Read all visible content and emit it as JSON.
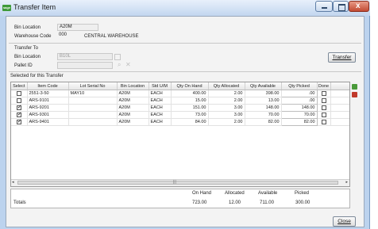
{
  "window": {
    "title": "Transfer Item",
    "logo": "sage"
  },
  "header": {
    "bin_location_label": "Bin Location",
    "bin_location_value": "A20M",
    "warehouse_code_label": "Warehouse Code",
    "warehouse_code_value": "000",
    "warehouse_name": "CENTRAL WAREHOUSE"
  },
  "transfer_to": {
    "section_label": "Transfer To",
    "bin_location_label": "Bin Location",
    "bin_location_value": "B10L",
    "pallet_id_label": "Pallet ID",
    "pallet_id_value": ""
  },
  "buttons": {
    "transfer": "Transfer",
    "close": "Close"
  },
  "grid": {
    "section_label": "Selected for this Transfer",
    "columns": [
      "Select",
      "Item Code",
      "Lot Serial No",
      "Bin Location",
      "Std U/M",
      "Qty On Hand",
      "Qty Allocated",
      "Qty Available",
      "Qty Picked",
      "Done"
    ],
    "rows": [
      {
        "select": false,
        "item_code": "2551-3-50",
        "lot_serial": "MAY10",
        "bin": "A20M",
        "um": "EACH",
        "on_hand": "400.00",
        "allocated": "2.00",
        "available": "398.00",
        "picked": ".00",
        "done": false
      },
      {
        "select": false,
        "item_code": "ARS-9101",
        "lot_serial": "",
        "bin": "A20M",
        "um": "EACH",
        "on_hand": "15.00",
        "allocated": "2.00",
        "available": "13.00",
        "picked": ".00",
        "done": false
      },
      {
        "select": true,
        "item_code": "ARS-9201",
        "lot_serial": "",
        "bin": "A20M",
        "um": "EACH",
        "on_hand": "151.00",
        "allocated": "3.00",
        "available": "148.00",
        "picked": "148.00",
        "done": false
      },
      {
        "select": true,
        "item_code": "ARS-9301",
        "lot_serial": "",
        "bin": "A20M",
        "um": "EACH",
        "on_hand": "73.00",
        "allocated": "3.00",
        "available": "70.00",
        "picked": "70.00",
        "done": false
      },
      {
        "select": true,
        "item_code": "ARS-9401",
        "lot_serial": "",
        "bin": "A20M",
        "um": "EACH",
        "on_hand": "84.00",
        "allocated": "2.00",
        "available": "82.00",
        "picked": "82.00",
        "done": false
      }
    ]
  },
  "totals": {
    "label": "Totals",
    "on_hand_label": "On Hand",
    "on_hand": "723.00",
    "allocated_label": "Allocated",
    "allocated": "12.00",
    "available_label": "Available",
    "available": "711.00",
    "picked_label": "Picked",
    "picked": "300.00"
  },
  "icons": {
    "side_top": "add-icon",
    "side_bottom": "delete-icon",
    "accent_green": "#4a9a3a",
    "accent_red": "#c0392b"
  }
}
